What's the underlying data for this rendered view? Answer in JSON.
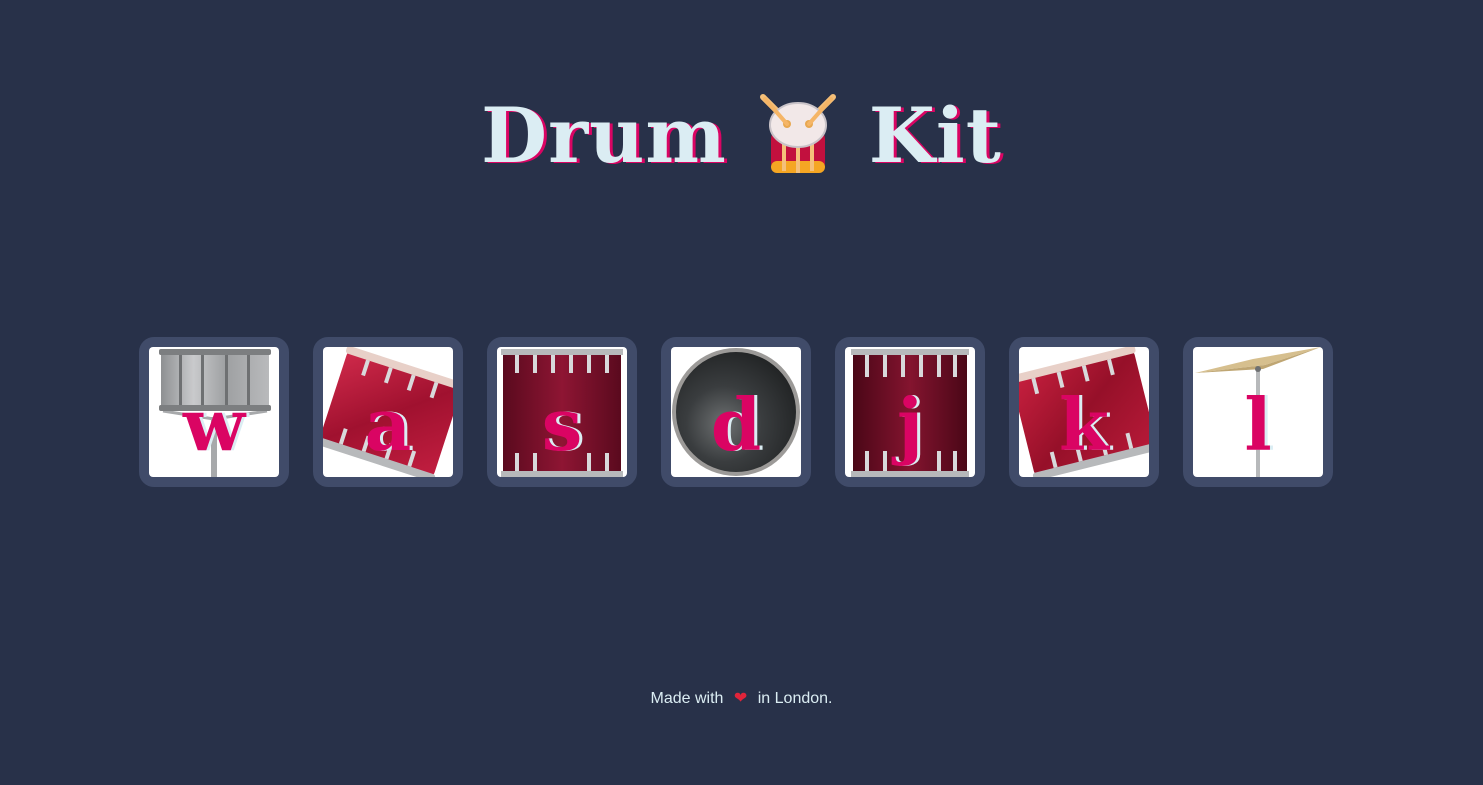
{
  "header": {
    "title_left": "Drum",
    "title_right": "Kit",
    "emoji_icon": "drum-with-drumsticks-icon"
  },
  "drum_set": {
    "buttons": [
      {
        "key": "w",
        "instrument": "tom-1"
      },
      {
        "key": "a",
        "instrument": "tom-2"
      },
      {
        "key": "s",
        "instrument": "tom-3"
      },
      {
        "key": "d",
        "instrument": "kick-bass"
      },
      {
        "key": "j",
        "instrument": "snare"
      },
      {
        "key": "k",
        "instrument": "tom-4"
      },
      {
        "key": "l",
        "instrument": "crash"
      }
    ]
  },
  "footer": {
    "prefix": "Made with",
    "heart": "❤",
    "suffix": "in London."
  },
  "colors": {
    "background": "#283149",
    "button_border": "#404B69",
    "title_text": "#DBEDF3",
    "accent": "#DA0463"
  }
}
